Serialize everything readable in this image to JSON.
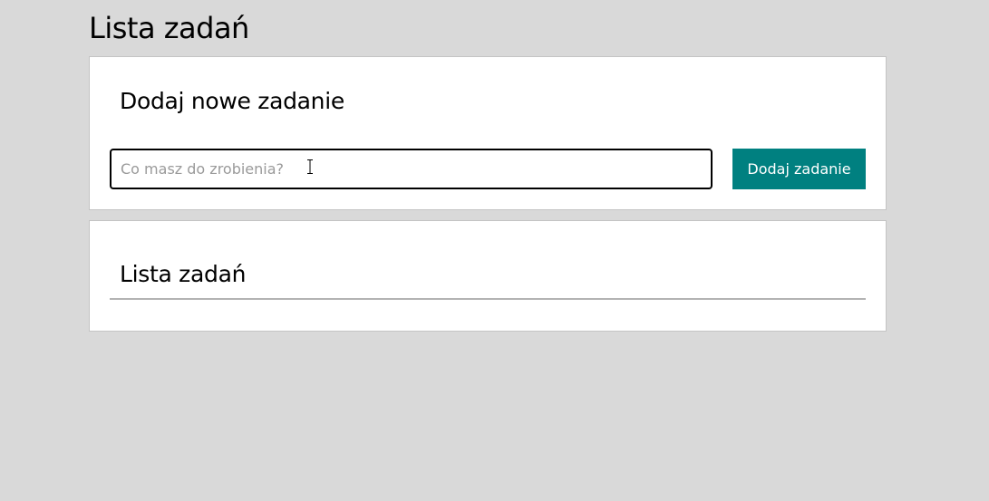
{
  "page": {
    "title": "Lista zadań"
  },
  "add_section": {
    "title": "Dodaj nowe zadanie",
    "input_placeholder": "Co masz do zrobienia?",
    "input_value": "",
    "button_label": "Dodaj zadanie",
    "button_color": "#008080"
  },
  "list_section": {
    "title": "Lista zadań",
    "items": []
  },
  "icons": {
    "cursor": "text-cursor-icon"
  },
  "colors": {
    "background": "#d9d9d9",
    "panel": "#ffffff",
    "accent": "#008080"
  }
}
